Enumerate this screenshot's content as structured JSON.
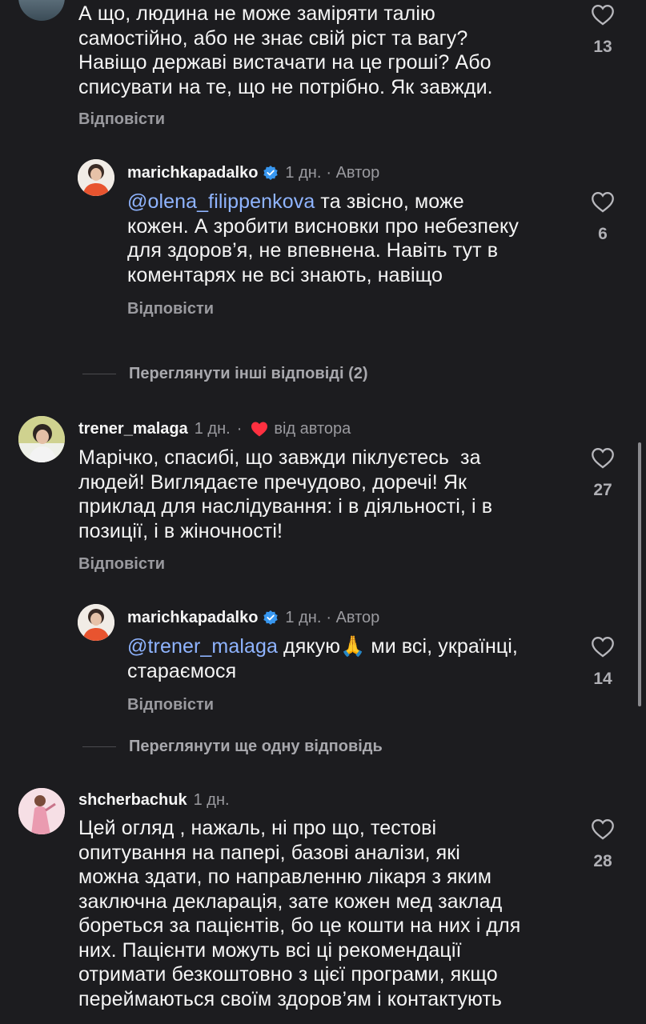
{
  "comments": [
    {
      "id": "c0",
      "text_lines": [
        "А що, людина не може заміряти талію",
        "самостійно, або не знає свій ріст та вагу?",
        "Навіщо державі вистачати на це гроші? Або",
        "списувати на те, що не потрібно. Як завжди."
      ],
      "likes": "13",
      "reply_label": "Відповісти"
    },
    {
      "id": "r0",
      "username": "marichkapadalko",
      "time": "1 дн.",
      "author_label": "Автор",
      "mention": "@olena_filippenkova",
      "text_lines": [
        " та звісно, може",
        "кожен. А зробити висновки про небезпеку",
        "для здоров’я, не впевнена. Навіть тут в",
        "коментарях не всі знають, навіщо"
      ],
      "likes": "6",
      "reply_label": "Відповісти"
    },
    {
      "id": "more1",
      "label": "Переглянути інші відповіді (2)"
    },
    {
      "id": "c1",
      "username": "trener_malaga",
      "time": "1 дн.",
      "liked_by_author_label": "від автора",
      "text_lines": [
        "Марічко, спасибі, що завжди піклуєтесь  за",
        "людей! Виглядаєте пречудово, доречі! Як",
        "приклад для наслідування: і в діяльності, і в",
        "позиції, і в жіночності!"
      ],
      "likes": "27",
      "reply_label": "Відповісти"
    },
    {
      "id": "r1",
      "username": "marichkapadalko",
      "time": "1 дн.",
      "author_label": "Автор",
      "mention": "@trener_malaga",
      "text_line1_after": " дякую",
      "emoji": "🙏",
      "text_line1_end": " ми всі, українці,",
      "text_line2": "стараємося",
      "likes": "14",
      "reply_label": "Відповісти"
    },
    {
      "id": "more2",
      "label": "Переглянути ще одну відповідь"
    },
    {
      "id": "c2",
      "username": "shcherbachuk",
      "time": "1 дн.",
      "text_lines": [
        "Цей огляд , нажаль, ні про що, тестові",
        "опитування на папері, базові аналізи, які",
        "можна здати, по направленню лікаря з яким",
        "заключна декларація, зате кожен мед заклад",
        "бореться за пацієнтів, бо це кошти на них і для",
        "них. Пацієнти можуть всі ці рекомендації",
        "отримати безкоштовно з цієї програми, якщо",
        "переймаються своїм здоров’ям і контактують"
      ],
      "likes": "28"
    }
  ],
  "colors": {
    "background": "#1c1c1f",
    "text": "#f5f5f5",
    "muted": "#9a9a9f",
    "mention": "#8fb4ff",
    "verified": "#3897f0",
    "heart_red": "#ff3040"
  }
}
